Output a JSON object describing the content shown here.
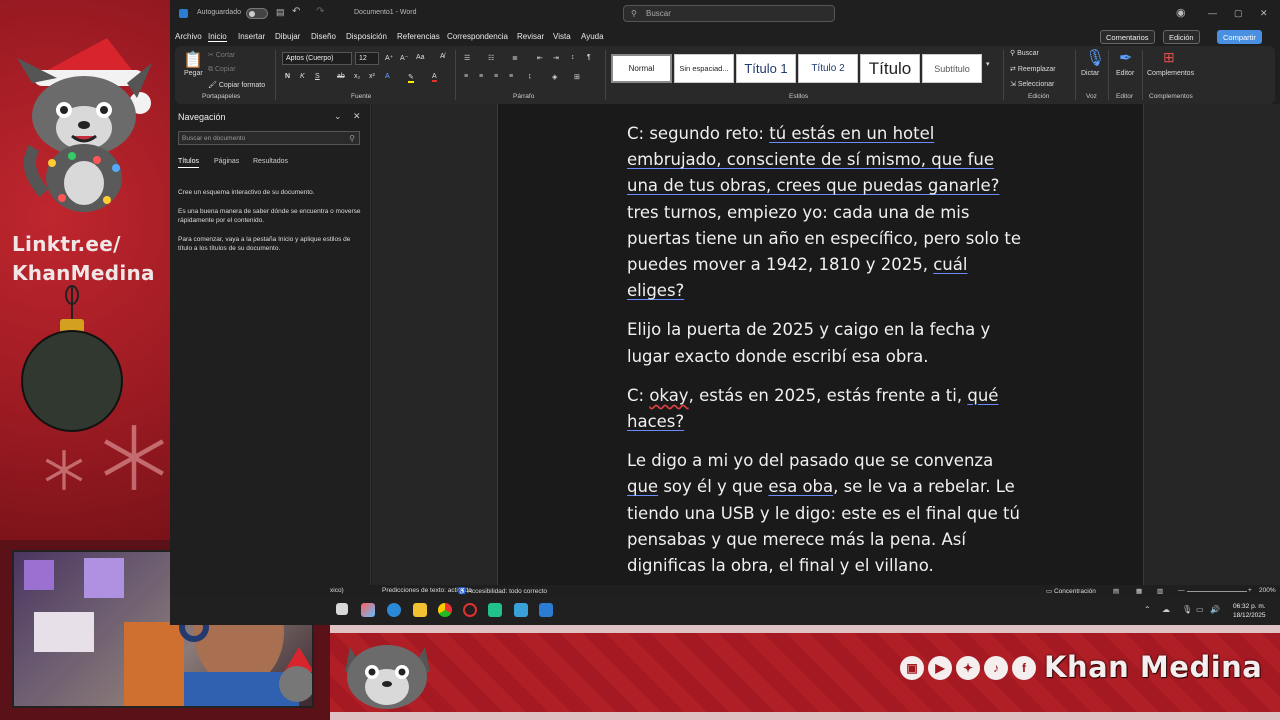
{
  "overlay": {
    "link_line1": "Linktr.ee/",
    "link_line2": "KhanMedina",
    "channel_name": "Khan Medina",
    "social_icons": [
      "twitch-icon",
      "youtube-icon",
      "twitter-icon",
      "tiktok-icon",
      "facebook-icon"
    ],
    "brand_color": "#b01e26"
  },
  "word": {
    "autosave_label": "Autoguardado",
    "doc_title": "Documento1 - Word",
    "search_placeholder": "Buscar",
    "menu": [
      "Archivo",
      "Inicio",
      "Insertar",
      "Dibujar",
      "Diseño",
      "Disposición",
      "Referencias",
      "Correspondencia",
      "Revisar",
      "Vista",
      "Ayuda"
    ],
    "comments_label": "Comentarios",
    "editing_label": "Edición",
    "share_label": "Compartir",
    "ribbon": {
      "paste": "Pegar",
      "cut": "Cortar",
      "copy": "Copiar",
      "format_painter": "Copiar formato",
      "clipboard": "Portapapeles",
      "font_name": "Aptos (Cuerpo)",
      "font_size": "12",
      "font_group": "Fuente",
      "paragraph_group": "Párrafo",
      "styles_group": "Estilos",
      "styles": [
        "Normal",
        "Sin espaciad...",
        "Título 1",
        "Título 2",
        "Título",
        "Subtítulo"
      ],
      "find": "Buscar",
      "replace": "Reemplazar",
      "select": "Seleccionar",
      "editing_group": "Edición",
      "dictate": "Dictar",
      "voice_group": "Voz",
      "editor": "Editor",
      "editor_group": "Editor",
      "addins": "Complementos",
      "addins_group": "Complementos"
    },
    "nav": {
      "title": "Navegación",
      "search_placeholder": "Buscar en documento",
      "tabs": [
        "Títulos",
        "Páginas",
        "Resultados"
      ],
      "text1": "Cree un esquema interactivo de su documento.",
      "text2": "Es una buena manera de saber dónde se encuentra o moverse rápidamente por el contenido.",
      "text3": "Para comenzar, vaya a la pestaña Inicio y aplique estilos de título a los títulos de su documento."
    },
    "doc": {
      "p1_a": "C: segundo reto: ",
      "p1_u1": "tú estás en un hotel embrujado, consciente de sí mismo, que fue una de tus obras, crees que puedas ganarle?",
      "p1_b": " tres turnos, empiezo yo: cada una de mis puertas tiene un año en específico, pero solo te puedes mover a 1942, 1810 y 2025, ",
      "p1_u2": "cuál eliges?",
      "p2": "Elijo la puerta de 2025 y caigo en la fecha y lugar exacto donde escribí esa obra.",
      "p3_a": "C: ",
      "p3_r": "okay",
      "p3_b": ", estás en 2025, estás frente a ti, ",
      "p3_u": "qué haces?",
      "p4_a": "Le digo a mi yo del pasado que se convenza ",
      "p4_u1": "que",
      "p4_b": " soy él y que ",
      "p4_u2": "esa oba",
      "p4_c": ", se le va a rebelar. Le tiendo una USB y le digo: este es el final que tú pensabas y que merece más la pena. Así dignificas la obra, el final y el villano."
    },
    "status": {
      "lang": "xico)",
      "predictions": "Predicciones de texto: activado",
      "accessibility": "Accesibilidad: todo correcto",
      "focus": "Concentración",
      "zoom": "200%"
    },
    "clock": {
      "time": "06:32 p. m.",
      "date": "18/12/2025"
    }
  }
}
